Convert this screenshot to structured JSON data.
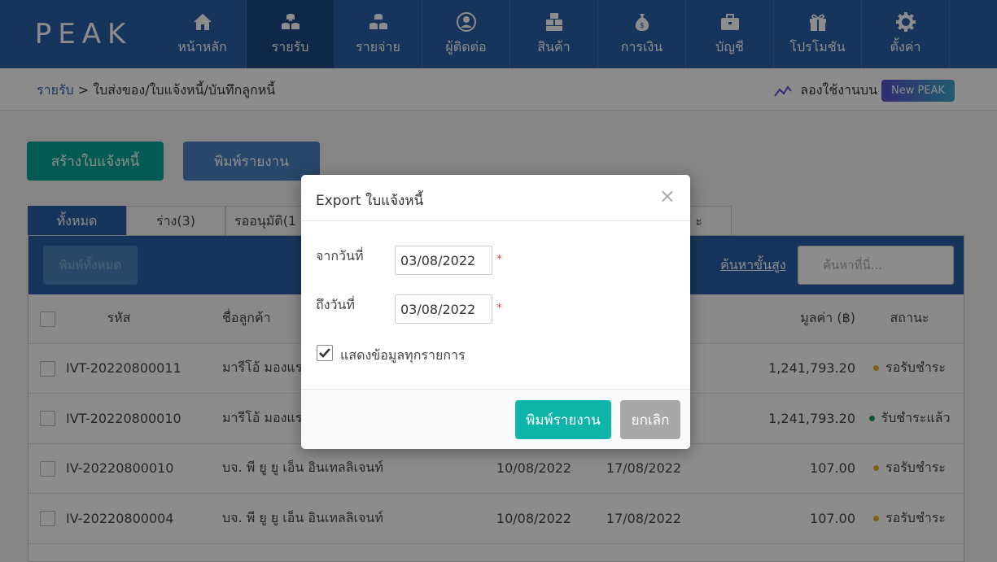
{
  "brand": {
    "logo": "PEAK"
  },
  "nav": [
    {
      "label": "หน้าหลัก",
      "icon": "home-icon"
    },
    {
      "label": "รายรับ",
      "icon": "coins-icon",
      "active": true
    },
    {
      "label": "รายจ่าย",
      "icon": "coins-out-icon"
    },
    {
      "label": "ผู้ติดต่อ",
      "icon": "user-icon"
    },
    {
      "label": "สินค้า",
      "icon": "boxes-icon"
    },
    {
      "label": "การเงิน",
      "icon": "money-bag-icon"
    },
    {
      "label": "บัญชี",
      "icon": "briefcase-icon"
    },
    {
      "label": "โปรโมชัน",
      "icon": "gift-icon"
    },
    {
      "label": "ตั้งค่า",
      "icon": "gear-icon"
    }
  ],
  "breadcrumb": {
    "root": "รายรับ",
    "sep": " > ",
    "current": "ใบส่งของ/ใบแจ้งหนี้/บันทึกลูกหนี้"
  },
  "trial": {
    "text": "ลองใช้งานบน",
    "badge": "New PEAK"
  },
  "actions": {
    "create": "สร้างใบแจ้งหนี้",
    "print_report": "พิมพ์รายงาน"
  },
  "tabs": [
    "ทั้งหมด",
    "ร่าง(3)",
    "รออนุมัติ(1",
    "ะ"
  ],
  "toolbar": {
    "print_all": "พิมพ์ทั้งหมด",
    "advanced_search": "ค้นหาขั้นสูง",
    "search_placeholder": "ค้นหาที่นี่..."
  },
  "table": {
    "headers": {
      "code": "รหัส",
      "customer": "ชื่อลูกค้า",
      "value": "มูลค่า (฿)",
      "status": "สถานะ"
    },
    "rows": [
      {
        "code": "IVT-20220800011",
        "customer": "มารีโอ้ มองแรง",
        "date1": "",
        "date2": "",
        "value": "1,241,793.20",
        "status": "รอรับชำระ",
        "status_color": "#e6b422"
      },
      {
        "code": "IVT-20220800010",
        "customer": "มารีโอ้ มองแรง",
        "date1": "",
        "date2": "",
        "value": "1,241,793.20",
        "status": "รับชำระแล้ว",
        "status_color": "#1a9e5a"
      },
      {
        "code": "IV-20220800010",
        "customer": "บจ. พี ยู ยู เอ็น อินเทลลิเจนท์",
        "date1": "10/08/2022",
        "date2": "17/08/2022",
        "value": "107.00",
        "status": "รอรับชำระ",
        "status_color": "#e6b422"
      },
      {
        "code": "IV-20220800004",
        "customer": "บจ. พี ยู ยู เอ็น อินเทลลิเจนท์",
        "date1": "10/08/2022",
        "date2": "17/08/2022",
        "value": "107.00",
        "status": "รอรับชำระ",
        "status_color": "#e6b422"
      }
    ]
  },
  "modal": {
    "title": "Export ใบแจ้งหนี้",
    "close": "×",
    "from_label": "จากวันที่",
    "from_value": "03/08/2022",
    "to_label": "ถึงวันที่",
    "to_value": "03/08/2022",
    "required_mark": "*",
    "show_all_label": "แสดงข้อมูลทุกรายการ",
    "show_all_checked": true,
    "print_button": "พิมพ์รายงาน",
    "cancel_button": "ยกเลิก"
  },
  "colors": {
    "nav": "#2a62a8",
    "nav_active": "#1d4a86",
    "teal": "#0aa79a",
    "modal_print": "#0fb5a9",
    "cancel": "#a8a8a8"
  }
}
